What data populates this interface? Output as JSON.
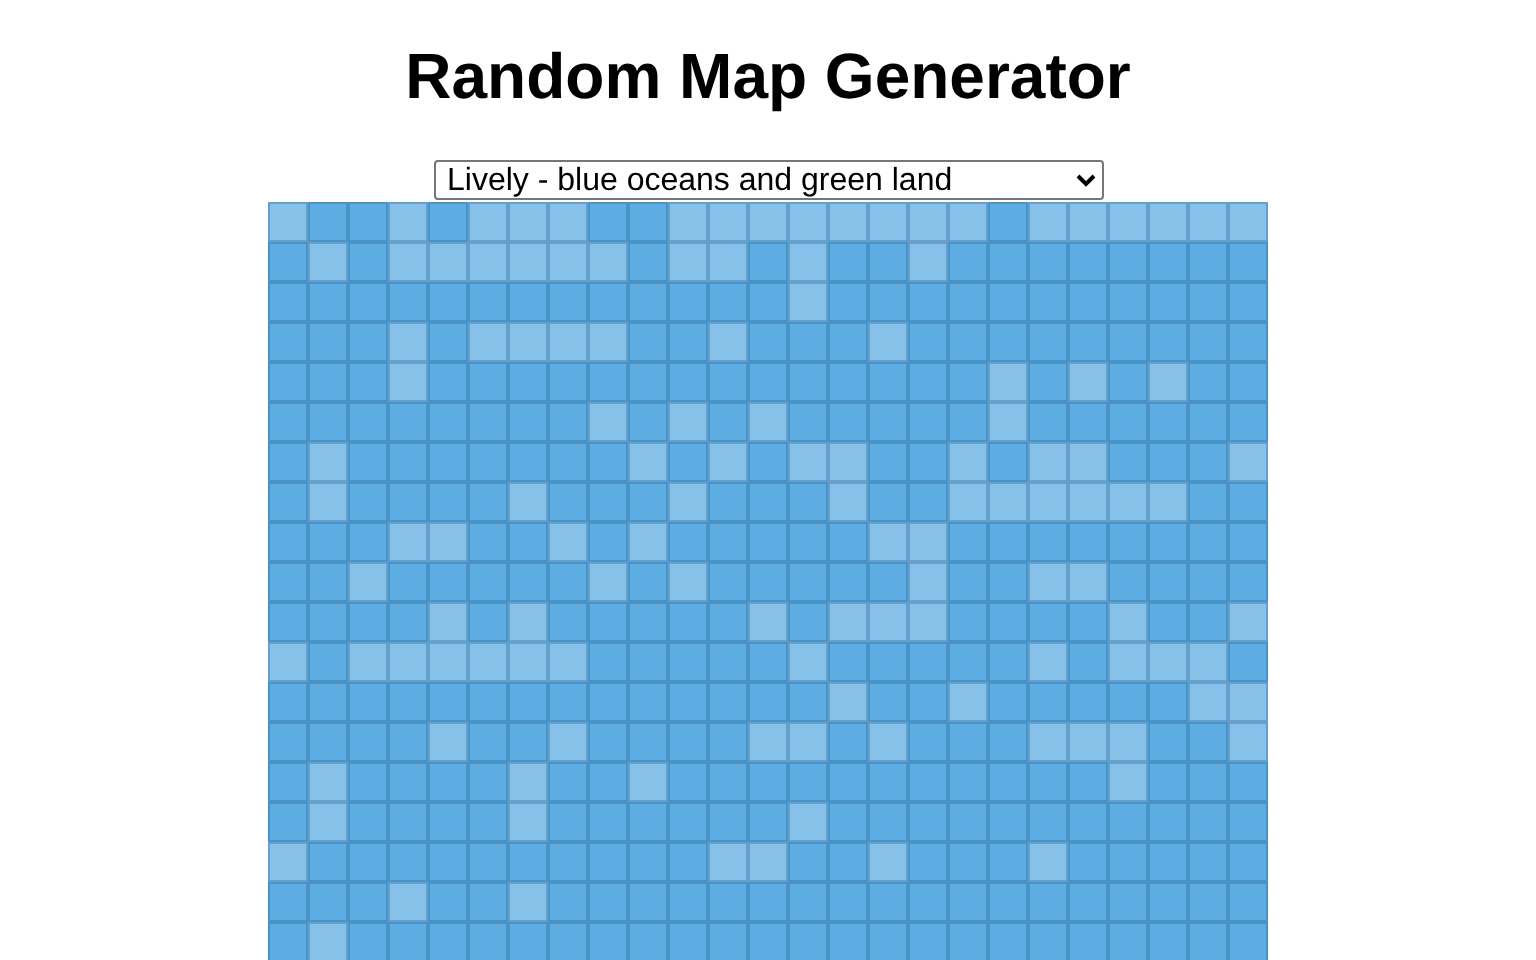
{
  "title": "Random Map Generator",
  "style_select": {
    "value": "Lively - blue oceans and green land"
  },
  "map": {
    "rows": [
      {
        "tiles": [
          {
            "color": "#85c1e9"
          },
          {
            "color": "#5dade2"
          },
          {
            "color": "#5dade2"
          },
          {
            "color": "#85c1e9"
          },
          {
            "color": "#5dade2"
          },
          {
            "color": "#85c1e9"
          },
          {
            "color": "#85c1e9"
          },
          {
            "color": "#85c1e9"
          },
          {
            "color": "#5dade2"
          },
          {
            "color": "#5dade2"
          },
          {
            "color": "#85c1e9"
          },
          {
            "color": "#85c1e9"
          },
          {
            "color": "#85c1e9"
          },
          {
            "color": "#85c1e9"
          },
          {
            "color": "#85c1e9"
          },
          {
            "color": "#85c1e9"
          },
          {
            "color": "#85c1e9"
          },
          {
            "color": "#85c1e9"
          },
          {
            "color": "#5dade2"
          },
          {
            "color": "#85c1e9"
          },
          {
            "color": "#85c1e9"
          },
          {
            "color": "#85c1e9"
          },
          {
            "color": "#85c1e9"
          },
          {
            "color": "#85c1e9"
          },
          {
            "color": "#85c1e9"
          }
        ]
      },
      {
        "tiles": [
          {
            "color": "#5dade2"
          },
          {
            "color": "#85c1e9"
          },
          {
            "color": "#5dade2"
          },
          {
            "color": "#85c1e9"
          },
          {
            "color": "#85c1e9"
          },
          {
            "color": "#85c1e9"
          },
          {
            "color": "#85c1e9"
          },
          {
            "color": "#85c1e9"
          },
          {
            "color": "#85c1e9"
          },
          {
            "color": "#5dade2"
          },
          {
            "color": "#85c1e9"
          },
          {
            "color": "#85c1e9"
          },
          {
            "color": "#5dade2"
          },
          {
            "color": "#85c1e9"
          },
          {
            "color": "#5dade2"
          },
          {
            "color": "#5dade2"
          },
          {
            "color": "#85c1e9"
          },
          {
            "color": "#5dade2"
          },
          {
            "color": "#5dade2"
          },
          {
            "color": "#5dade2"
          },
          {
            "color": "#5dade2"
          },
          {
            "color": "#5dade2"
          },
          {
            "color": "#5dade2"
          },
          {
            "color": "#5dade2"
          },
          {
            "color": "#5dade2"
          }
        ]
      },
      {
        "tiles": [
          {
            "color": "#5dade2"
          },
          {
            "color": "#5dade2"
          },
          {
            "color": "#5dade2"
          },
          {
            "color": "#5dade2"
          },
          {
            "color": "#5dade2"
          },
          {
            "color": "#5dade2"
          },
          {
            "color": "#5dade2"
          },
          {
            "color": "#5dade2"
          },
          {
            "color": "#5dade2"
          },
          {
            "color": "#5dade2"
          },
          {
            "color": "#5dade2"
          },
          {
            "color": "#5dade2"
          },
          {
            "color": "#5dade2"
          },
          {
            "color": "#85c1e9"
          },
          {
            "color": "#5dade2"
          },
          {
            "color": "#5dade2"
          },
          {
            "color": "#5dade2"
          },
          {
            "color": "#5dade2"
          },
          {
            "color": "#5dade2"
          },
          {
            "color": "#5dade2"
          },
          {
            "color": "#5dade2"
          },
          {
            "color": "#5dade2"
          },
          {
            "color": "#5dade2"
          },
          {
            "color": "#5dade2"
          },
          {
            "color": "#5dade2"
          }
        ]
      },
      {
        "tiles": [
          {
            "color": "#5dade2"
          },
          {
            "color": "#5dade2"
          },
          {
            "color": "#5dade2"
          },
          {
            "color": "#85c1e9"
          },
          {
            "color": "#5dade2"
          },
          {
            "color": "#85c1e9"
          },
          {
            "color": "#85c1e9"
          },
          {
            "color": "#85c1e9"
          },
          {
            "color": "#85c1e9"
          },
          {
            "color": "#5dade2"
          },
          {
            "color": "#5dade2"
          },
          {
            "color": "#85c1e9"
          },
          {
            "color": "#5dade2"
          },
          {
            "color": "#5dade2"
          },
          {
            "color": "#5dade2"
          },
          {
            "color": "#85c1e9"
          },
          {
            "color": "#5dade2"
          },
          {
            "color": "#5dade2"
          },
          {
            "color": "#5dade2"
          },
          {
            "color": "#5dade2"
          },
          {
            "color": "#5dade2"
          },
          {
            "color": "#5dade2"
          },
          {
            "color": "#5dade2"
          },
          {
            "color": "#5dade2"
          },
          {
            "color": "#5dade2"
          }
        ]
      },
      {
        "tiles": [
          {
            "color": "#5dade2"
          },
          {
            "color": "#5dade2"
          },
          {
            "color": "#5dade2"
          },
          {
            "color": "#85c1e9"
          },
          {
            "color": "#5dade2"
          },
          {
            "color": "#5dade2"
          },
          {
            "color": "#5dade2"
          },
          {
            "color": "#5dade2"
          },
          {
            "color": "#5dade2"
          },
          {
            "color": "#5dade2"
          },
          {
            "color": "#5dade2"
          },
          {
            "color": "#5dade2"
          },
          {
            "color": "#5dade2"
          },
          {
            "color": "#5dade2"
          },
          {
            "color": "#5dade2"
          },
          {
            "color": "#5dade2"
          },
          {
            "color": "#5dade2"
          },
          {
            "color": "#5dade2"
          },
          {
            "color": "#85c1e9"
          },
          {
            "color": "#5dade2"
          },
          {
            "color": "#85c1e9"
          },
          {
            "color": "#5dade2"
          },
          {
            "color": "#85c1e9"
          },
          {
            "color": "#5dade2"
          },
          {
            "color": "#5dade2"
          }
        ]
      },
      {
        "tiles": [
          {
            "color": "#5dade2"
          },
          {
            "color": "#5dade2"
          },
          {
            "color": "#5dade2"
          },
          {
            "color": "#5dade2"
          },
          {
            "color": "#5dade2"
          },
          {
            "color": "#5dade2"
          },
          {
            "color": "#5dade2"
          },
          {
            "color": "#5dade2"
          },
          {
            "color": "#85c1e9"
          },
          {
            "color": "#5dade2"
          },
          {
            "color": "#85c1e9"
          },
          {
            "color": "#5dade2"
          },
          {
            "color": "#85c1e9"
          },
          {
            "color": "#5dade2"
          },
          {
            "color": "#5dade2"
          },
          {
            "color": "#5dade2"
          },
          {
            "color": "#5dade2"
          },
          {
            "color": "#5dade2"
          },
          {
            "color": "#85c1e9"
          },
          {
            "color": "#5dade2"
          },
          {
            "color": "#5dade2"
          },
          {
            "color": "#5dade2"
          },
          {
            "color": "#5dade2"
          },
          {
            "color": "#5dade2"
          },
          {
            "color": "#5dade2"
          }
        ]
      },
      {
        "tiles": [
          {
            "color": "#5dade2"
          },
          {
            "color": "#85c1e9"
          },
          {
            "color": "#5dade2"
          },
          {
            "color": "#5dade2"
          },
          {
            "color": "#5dade2"
          },
          {
            "color": "#5dade2"
          },
          {
            "color": "#5dade2"
          },
          {
            "color": "#5dade2"
          },
          {
            "color": "#5dade2"
          },
          {
            "color": "#85c1e9"
          },
          {
            "color": "#5dade2"
          },
          {
            "color": "#85c1e9"
          },
          {
            "color": "#5dade2"
          },
          {
            "color": "#85c1e9"
          },
          {
            "color": "#85c1e9"
          },
          {
            "color": "#5dade2"
          },
          {
            "color": "#5dade2"
          },
          {
            "color": "#85c1e9"
          },
          {
            "color": "#5dade2"
          },
          {
            "color": "#85c1e9"
          },
          {
            "color": "#85c1e9"
          },
          {
            "color": "#5dade2"
          },
          {
            "color": "#5dade2"
          },
          {
            "color": "#5dade2"
          },
          {
            "color": "#85c1e9"
          }
        ]
      },
      {
        "tiles": [
          {
            "color": "#5dade2"
          },
          {
            "color": "#85c1e9"
          },
          {
            "color": "#5dade2"
          },
          {
            "color": "#5dade2"
          },
          {
            "color": "#5dade2"
          },
          {
            "color": "#5dade2"
          },
          {
            "color": "#85c1e9"
          },
          {
            "color": "#5dade2"
          },
          {
            "color": "#5dade2"
          },
          {
            "color": "#5dade2"
          },
          {
            "color": "#85c1e9"
          },
          {
            "color": "#5dade2"
          },
          {
            "color": "#5dade2"
          },
          {
            "color": "#5dade2"
          },
          {
            "color": "#85c1e9"
          },
          {
            "color": "#5dade2"
          },
          {
            "color": "#5dade2"
          },
          {
            "color": "#85c1e9"
          },
          {
            "color": "#85c1e9"
          },
          {
            "color": "#85c1e9"
          },
          {
            "color": "#85c1e9"
          },
          {
            "color": "#85c1e9"
          },
          {
            "color": "#85c1e9"
          },
          {
            "color": "#5dade2"
          },
          {
            "color": "#5dade2"
          }
        ]
      },
      {
        "tiles": [
          {
            "color": "#5dade2"
          },
          {
            "color": "#5dade2"
          },
          {
            "color": "#5dade2"
          },
          {
            "color": "#85c1e9"
          },
          {
            "color": "#85c1e9"
          },
          {
            "color": "#5dade2"
          },
          {
            "color": "#5dade2"
          },
          {
            "color": "#85c1e9"
          },
          {
            "color": "#5dade2"
          },
          {
            "color": "#85c1e9"
          },
          {
            "color": "#5dade2"
          },
          {
            "color": "#5dade2"
          },
          {
            "color": "#5dade2"
          },
          {
            "color": "#5dade2"
          },
          {
            "color": "#5dade2"
          },
          {
            "color": "#85c1e9"
          },
          {
            "color": "#85c1e9"
          },
          {
            "color": "#5dade2"
          },
          {
            "color": "#5dade2"
          },
          {
            "color": "#5dade2"
          },
          {
            "color": "#5dade2"
          },
          {
            "color": "#5dade2"
          },
          {
            "color": "#5dade2"
          },
          {
            "color": "#5dade2"
          },
          {
            "color": "#5dade2"
          }
        ]
      },
      {
        "tiles": [
          {
            "color": "#5dade2"
          },
          {
            "color": "#5dade2"
          },
          {
            "color": "#85c1e9"
          },
          {
            "color": "#5dade2"
          },
          {
            "color": "#5dade2"
          },
          {
            "color": "#5dade2"
          },
          {
            "color": "#5dade2"
          },
          {
            "color": "#5dade2"
          },
          {
            "color": "#85c1e9"
          },
          {
            "color": "#5dade2"
          },
          {
            "color": "#85c1e9"
          },
          {
            "color": "#5dade2"
          },
          {
            "color": "#5dade2"
          },
          {
            "color": "#5dade2"
          },
          {
            "color": "#5dade2"
          },
          {
            "color": "#5dade2"
          },
          {
            "color": "#85c1e9"
          },
          {
            "color": "#5dade2"
          },
          {
            "color": "#5dade2"
          },
          {
            "color": "#85c1e9"
          },
          {
            "color": "#85c1e9"
          },
          {
            "color": "#5dade2"
          },
          {
            "color": "#5dade2"
          },
          {
            "color": "#5dade2"
          },
          {
            "color": "#5dade2"
          }
        ]
      },
      {
        "tiles": [
          {
            "color": "#5dade2"
          },
          {
            "color": "#5dade2"
          },
          {
            "color": "#5dade2"
          },
          {
            "color": "#5dade2"
          },
          {
            "color": "#85c1e9"
          },
          {
            "color": "#5dade2"
          },
          {
            "color": "#85c1e9"
          },
          {
            "color": "#5dade2"
          },
          {
            "color": "#5dade2"
          },
          {
            "color": "#5dade2"
          },
          {
            "color": "#5dade2"
          },
          {
            "color": "#5dade2"
          },
          {
            "color": "#85c1e9"
          },
          {
            "color": "#5dade2"
          },
          {
            "color": "#85c1e9"
          },
          {
            "color": "#85c1e9"
          },
          {
            "color": "#85c1e9"
          },
          {
            "color": "#5dade2"
          },
          {
            "color": "#5dade2"
          },
          {
            "color": "#5dade2"
          },
          {
            "color": "#5dade2"
          },
          {
            "color": "#85c1e9"
          },
          {
            "color": "#5dade2"
          },
          {
            "color": "#5dade2"
          },
          {
            "color": "#85c1e9"
          }
        ]
      },
      {
        "tiles": [
          {
            "color": "#85c1e9"
          },
          {
            "color": "#5dade2"
          },
          {
            "color": "#85c1e9"
          },
          {
            "color": "#85c1e9"
          },
          {
            "color": "#85c1e9"
          },
          {
            "color": "#85c1e9"
          },
          {
            "color": "#85c1e9"
          },
          {
            "color": "#85c1e9"
          },
          {
            "color": "#5dade2"
          },
          {
            "color": "#5dade2"
          },
          {
            "color": "#5dade2"
          },
          {
            "color": "#5dade2"
          },
          {
            "color": "#5dade2"
          },
          {
            "color": "#85c1e9"
          },
          {
            "color": "#5dade2"
          },
          {
            "color": "#5dade2"
          },
          {
            "color": "#5dade2"
          },
          {
            "color": "#5dade2"
          },
          {
            "color": "#5dade2"
          },
          {
            "color": "#85c1e9"
          },
          {
            "color": "#5dade2"
          },
          {
            "color": "#85c1e9"
          },
          {
            "color": "#85c1e9"
          },
          {
            "color": "#85c1e9"
          },
          {
            "color": "#5dade2"
          }
        ]
      },
      {
        "tiles": [
          {
            "color": "#5dade2"
          },
          {
            "color": "#5dade2"
          },
          {
            "color": "#5dade2"
          },
          {
            "color": "#5dade2"
          },
          {
            "color": "#5dade2"
          },
          {
            "color": "#5dade2"
          },
          {
            "color": "#5dade2"
          },
          {
            "color": "#5dade2"
          },
          {
            "color": "#5dade2"
          },
          {
            "color": "#5dade2"
          },
          {
            "color": "#5dade2"
          },
          {
            "color": "#5dade2"
          },
          {
            "color": "#5dade2"
          },
          {
            "color": "#5dade2"
          },
          {
            "color": "#85c1e9"
          },
          {
            "color": "#5dade2"
          },
          {
            "color": "#5dade2"
          },
          {
            "color": "#85c1e9"
          },
          {
            "color": "#5dade2"
          },
          {
            "color": "#5dade2"
          },
          {
            "color": "#5dade2"
          },
          {
            "color": "#5dade2"
          },
          {
            "color": "#5dade2"
          },
          {
            "color": "#85c1e9"
          },
          {
            "color": "#85c1e9"
          }
        ]
      },
      {
        "tiles": [
          {
            "color": "#5dade2"
          },
          {
            "color": "#5dade2"
          },
          {
            "color": "#5dade2"
          },
          {
            "color": "#5dade2"
          },
          {
            "color": "#85c1e9"
          },
          {
            "color": "#5dade2"
          },
          {
            "color": "#5dade2"
          },
          {
            "color": "#85c1e9"
          },
          {
            "color": "#5dade2"
          },
          {
            "color": "#5dade2"
          },
          {
            "color": "#5dade2"
          },
          {
            "color": "#5dade2"
          },
          {
            "color": "#85c1e9"
          },
          {
            "color": "#85c1e9"
          },
          {
            "color": "#5dade2"
          },
          {
            "color": "#85c1e9"
          },
          {
            "color": "#5dade2"
          },
          {
            "color": "#5dade2"
          },
          {
            "color": "#5dade2"
          },
          {
            "color": "#85c1e9"
          },
          {
            "color": "#85c1e9"
          },
          {
            "color": "#85c1e9"
          },
          {
            "color": "#5dade2"
          },
          {
            "color": "#5dade2"
          },
          {
            "color": "#85c1e9"
          }
        ]
      },
      {
        "tiles": [
          {
            "color": "#5dade2"
          },
          {
            "color": "#85c1e9"
          },
          {
            "color": "#5dade2"
          },
          {
            "color": "#5dade2"
          },
          {
            "color": "#5dade2"
          },
          {
            "color": "#5dade2"
          },
          {
            "color": "#85c1e9"
          },
          {
            "color": "#5dade2"
          },
          {
            "color": "#5dade2"
          },
          {
            "color": "#85c1e9"
          },
          {
            "color": "#5dade2"
          },
          {
            "color": "#5dade2"
          },
          {
            "color": "#5dade2"
          },
          {
            "color": "#5dade2"
          },
          {
            "color": "#5dade2"
          },
          {
            "color": "#5dade2"
          },
          {
            "color": "#5dade2"
          },
          {
            "color": "#5dade2"
          },
          {
            "color": "#5dade2"
          },
          {
            "color": "#5dade2"
          },
          {
            "color": "#5dade2"
          },
          {
            "color": "#85c1e9"
          },
          {
            "color": "#5dade2"
          },
          {
            "color": "#5dade2"
          },
          {
            "color": "#5dade2"
          }
        ]
      },
      {
        "tiles": [
          {
            "color": "#5dade2"
          },
          {
            "color": "#85c1e9"
          },
          {
            "color": "#5dade2"
          },
          {
            "color": "#5dade2"
          },
          {
            "color": "#5dade2"
          },
          {
            "color": "#5dade2"
          },
          {
            "color": "#85c1e9"
          },
          {
            "color": "#5dade2"
          },
          {
            "color": "#5dade2"
          },
          {
            "color": "#5dade2"
          },
          {
            "color": "#5dade2"
          },
          {
            "color": "#5dade2"
          },
          {
            "color": "#5dade2"
          },
          {
            "color": "#85c1e9"
          },
          {
            "color": "#5dade2"
          },
          {
            "color": "#5dade2"
          },
          {
            "color": "#5dade2"
          },
          {
            "color": "#5dade2"
          },
          {
            "color": "#5dade2"
          },
          {
            "color": "#5dade2"
          },
          {
            "color": "#5dade2"
          },
          {
            "color": "#5dade2"
          },
          {
            "color": "#5dade2"
          },
          {
            "color": "#5dade2"
          },
          {
            "color": "#5dade2"
          }
        ]
      },
      {
        "tiles": [
          {
            "color": "#85c1e9"
          },
          {
            "color": "#5dade2"
          },
          {
            "color": "#5dade2"
          },
          {
            "color": "#5dade2"
          },
          {
            "color": "#5dade2"
          },
          {
            "color": "#5dade2"
          },
          {
            "color": "#5dade2"
          },
          {
            "color": "#5dade2"
          },
          {
            "color": "#5dade2"
          },
          {
            "color": "#5dade2"
          },
          {
            "color": "#5dade2"
          },
          {
            "color": "#85c1e9"
          },
          {
            "color": "#85c1e9"
          },
          {
            "color": "#5dade2"
          },
          {
            "color": "#5dade2"
          },
          {
            "color": "#85c1e9"
          },
          {
            "color": "#5dade2"
          },
          {
            "color": "#5dade2"
          },
          {
            "color": "#5dade2"
          },
          {
            "color": "#85c1e9"
          },
          {
            "color": "#5dade2"
          },
          {
            "color": "#5dade2"
          },
          {
            "color": "#5dade2"
          },
          {
            "color": "#5dade2"
          },
          {
            "color": "#5dade2"
          }
        ]
      },
      {
        "tiles": [
          {
            "color": "#5dade2"
          },
          {
            "color": "#5dade2"
          },
          {
            "color": "#5dade2"
          },
          {
            "color": "#85c1e9"
          },
          {
            "color": "#5dade2"
          },
          {
            "color": "#5dade2"
          },
          {
            "color": "#85c1e9"
          },
          {
            "color": "#5dade2"
          },
          {
            "color": "#5dade2"
          },
          {
            "color": "#5dade2"
          },
          {
            "color": "#5dade2"
          },
          {
            "color": "#5dade2"
          },
          {
            "color": "#5dade2"
          },
          {
            "color": "#5dade2"
          },
          {
            "color": "#5dade2"
          },
          {
            "color": "#5dade2"
          },
          {
            "color": "#5dade2"
          },
          {
            "color": "#5dade2"
          },
          {
            "color": "#5dade2"
          },
          {
            "color": "#5dade2"
          },
          {
            "color": "#5dade2"
          },
          {
            "color": "#5dade2"
          },
          {
            "color": "#5dade2"
          },
          {
            "color": "#5dade2"
          },
          {
            "color": "#5dade2"
          }
        ]
      },
      {
        "tiles": [
          {
            "color": "#5dade2"
          },
          {
            "color": "#85c1e9"
          },
          {
            "color": "#5dade2"
          },
          {
            "color": "#5dade2"
          },
          {
            "color": "#5dade2"
          },
          {
            "color": "#5dade2"
          },
          {
            "color": "#5dade2"
          },
          {
            "color": "#5dade2"
          },
          {
            "color": "#5dade2"
          },
          {
            "color": "#5dade2"
          },
          {
            "color": "#5dade2"
          },
          {
            "color": "#5dade2"
          },
          {
            "color": "#5dade2"
          },
          {
            "color": "#5dade2"
          },
          {
            "color": "#5dade2"
          },
          {
            "color": "#5dade2"
          },
          {
            "color": "#5dade2"
          },
          {
            "color": "#5dade2"
          },
          {
            "color": "#5dade2"
          },
          {
            "color": "#5dade2"
          },
          {
            "color": "#5dade2"
          },
          {
            "color": "#5dade2"
          },
          {
            "color": "#5dade2"
          },
          {
            "color": "#5dade2"
          },
          {
            "color": "#5dade2"
          }
        ]
      }
    ]
  }
}
